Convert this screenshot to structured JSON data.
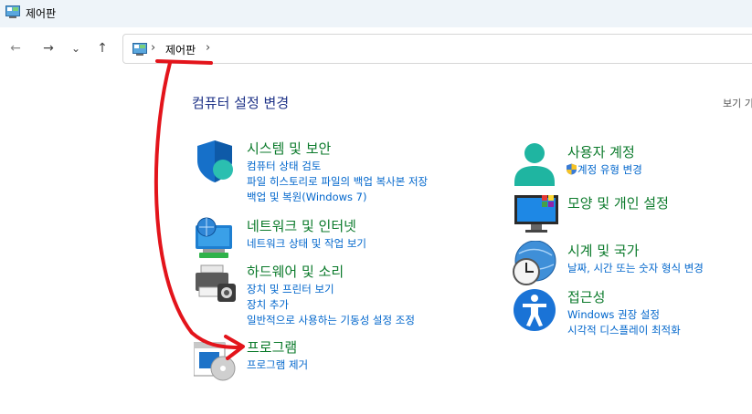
{
  "window": {
    "title": "제어판"
  },
  "nav": {
    "back": "←",
    "forward": "→",
    "recent": "⌄",
    "up": "↑"
  },
  "address": {
    "sep1": "›",
    "crumb": "제어판",
    "sep2": "›"
  },
  "main": {
    "heading": "컴퓨터 설정 변경",
    "view_by": "보기 기"
  },
  "left_categories": [
    {
      "title": "시스템 및 보안",
      "links": [
        "컴퓨터 상태 검토",
        "파일 히스토리로 파일의 백업 복사본 저장",
        "백업 및 복원(Windows 7)"
      ],
      "icon": "shield-icon"
    },
    {
      "title": "네트워크 및 인터넷",
      "links": [
        "네트워크 상태 및 작업 보기"
      ],
      "icon": "network-icon"
    },
    {
      "title": "하드웨어 및 소리",
      "links": [
        "장치 및 프린터 보기",
        "장치 추가",
        "일반적으로 사용하는 기동성 설정 조정"
      ],
      "icon": "printer-icon"
    },
    {
      "title": "프로그램",
      "links": [
        "프로그램 제거"
      ],
      "icon": "programs-icon"
    }
  ],
  "right_categories": [
    {
      "title": "사용자 계정",
      "links": [
        "계정 유형 변경"
      ],
      "icon": "user-icon"
    },
    {
      "title": "모양 및 개인 설정",
      "links": [],
      "icon": "monitor-icon"
    },
    {
      "title": "시계 및 국가",
      "links": [
        "날짜, 시간 또는 숫자 형식 변경"
      ],
      "icon": "clock-icon"
    },
    {
      "title": "접근성",
      "links": [
        "Windows 권장 설정",
        "시각적 디스플레이 최적화"
      ],
      "icon": "accessibility-icon"
    }
  ],
  "colors": {
    "category_title": "#0b7a2b",
    "link": "#0066cc",
    "heading": "#1e3287",
    "annotation": "#e3141b"
  }
}
